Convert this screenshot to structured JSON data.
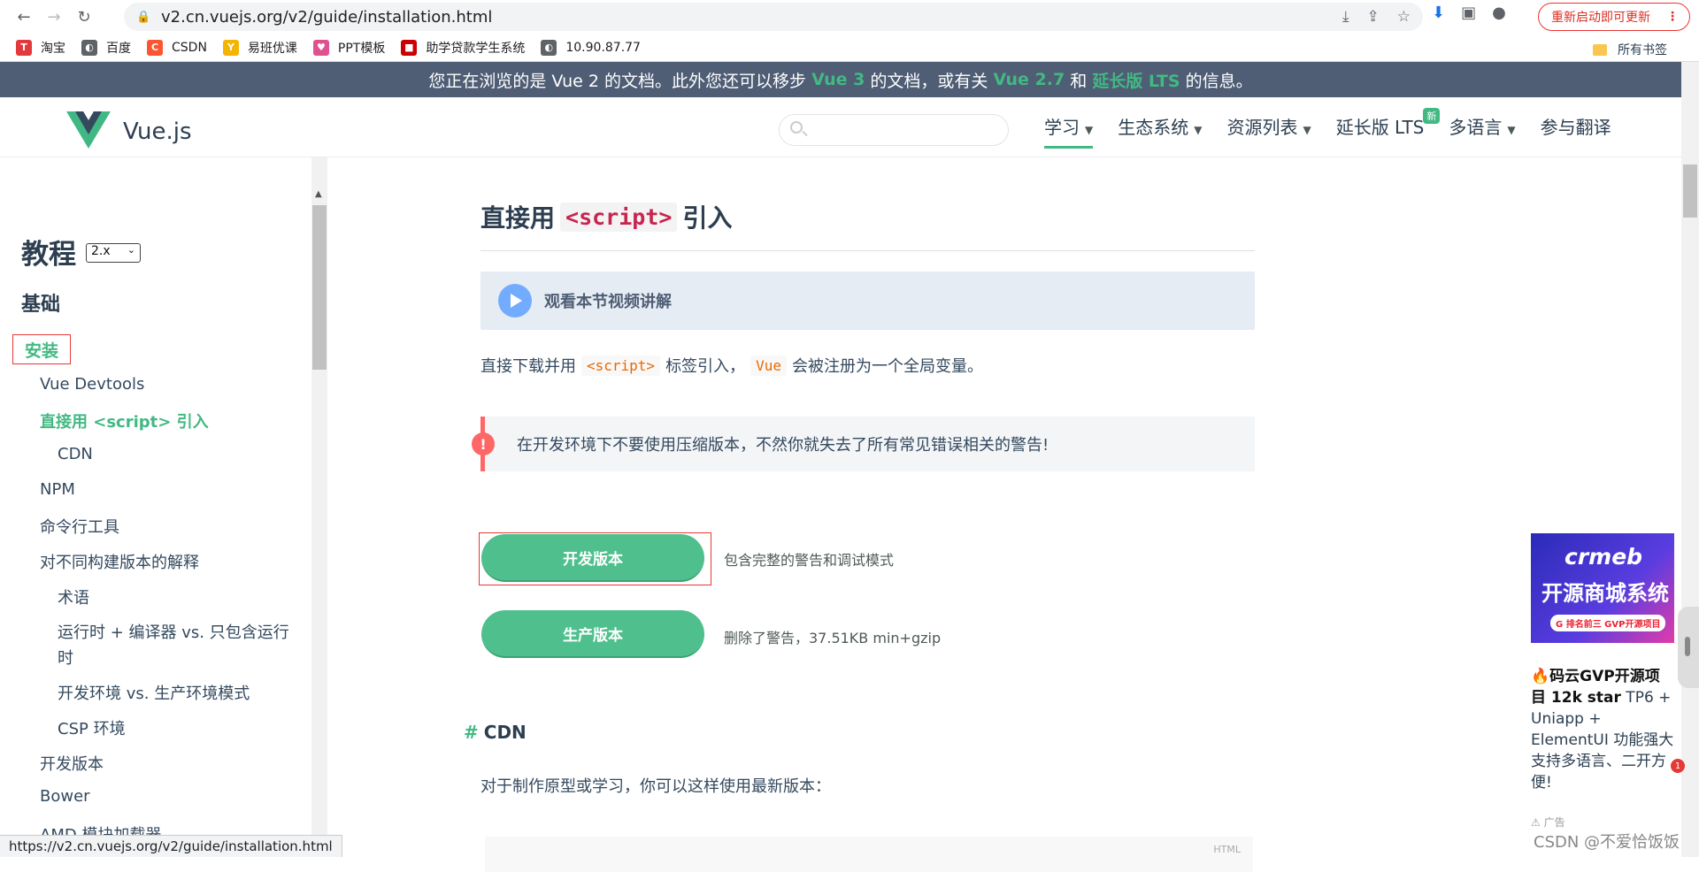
{
  "browser": {
    "url": "v2.cn.vuejs.org/v2/guide/installation.html",
    "restart_label": "重新启动即可更新",
    "bookmarks": [
      {
        "label": "淘宝",
        "color": "#e4393c",
        "glyph": "T"
      },
      {
        "label": "百度",
        "color": "#5f6368",
        "glyph": "◐"
      },
      {
        "label": "CSDN",
        "color": "#fc5531",
        "glyph": "C"
      },
      {
        "label": "易班优课",
        "color": "#f5b400",
        "glyph": "Y"
      },
      {
        "label": "PPT模板",
        "color": "#e0528f",
        "glyph": "♥"
      },
      {
        "label": "助学贷款学生系统",
        "color": "#c00",
        "glyph": "■"
      },
      {
        "label": "10.90.87.77",
        "color": "#5f6368",
        "glyph": "◐"
      }
    ],
    "all_bookmarks": "所有书签",
    "status_url": "https://v2.cn.vuejs.org/v2/guide/installation.html"
  },
  "banner": {
    "p1": "您正在浏览的是 Vue 2 的文档。此外您还可以移步",
    "l1": "Vue 3",
    "p2": "的文档，或有关",
    "l2": "Vue 2.7",
    "p3": "和",
    "l3": "延长版 LTS",
    "p4": "的信息。"
  },
  "header": {
    "brand": "Vue.js",
    "nav": [
      {
        "label": "学习",
        "caret": "▼"
      },
      {
        "label": "生态系统",
        "caret": "▼"
      },
      {
        "label": "资源列表",
        "caret": "▼"
      },
      {
        "label": "延长版 LTS",
        "badge": "新"
      },
      {
        "label": "多语言",
        "caret": "▼"
      },
      {
        "label": "参与翻译"
      }
    ]
  },
  "sidebar": {
    "title": "教程",
    "version": "2.x",
    "section": "基础",
    "install": "安装",
    "links": [
      "Vue Devtools",
      "直接用 <script> 引入",
      "CDN",
      "NPM",
      "命令行工具",
      "对不同构建版本的解释",
      "术语",
      "运行时 + 编译器 vs. 只包含运行",
      "时",
      "开发环境 vs. 生产环境模式",
      "CSP 环境",
      "开发版本",
      "Bower",
      "AMD 模块加载器"
    ]
  },
  "main": {
    "h2_pre": "直接用",
    "h2_code": "<script>",
    "h2_post": "引入",
    "video": "观看本节视频讲解",
    "para1_a": "直接下载并用",
    "para1_code1": "<script>",
    "para1_b": "标签引入，",
    "para1_code2": "Vue",
    "para1_c": "会被注册为一个全局变量。",
    "tip": "在开发环境下不要使用压缩版本，不然你就失去了所有常见错误相关的警告!",
    "btn_dev": "开发版本",
    "btn_dev_note": "包含完整的警告和调试模式",
    "btn_prod": "生产版本",
    "btn_prod_note": "删除了警告，37.51KB min+gzip",
    "h3": "CDN",
    "para2": "对于制作原型或学习，你可以这样使用最新版本：",
    "code_lang": "HTML"
  },
  "ad": {
    "img_t1": "crmeb",
    "img_t2": "开源商城系统",
    "img_t3": "G 排名前三 GVP开源项目",
    "text_bold": "🔥码云GVP开源项目 12k star",
    "text": " TP6 + Uniapp + ElementUI 功能强大支持多语言、二开方便!",
    "mark": "广告",
    "badge": "1"
  },
  "watermark": "CSDN @不爱恰饭饭"
}
